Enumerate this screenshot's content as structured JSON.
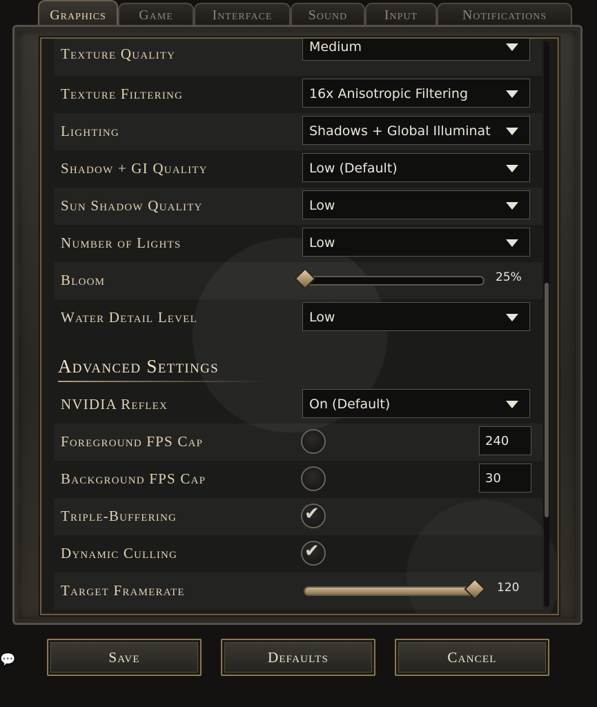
{
  "tabs": [
    {
      "label": "Graphics",
      "active": true
    },
    {
      "label": "Game",
      "active": false
    },
    {
      "label": "Interface",
      "active": false
    },
    {
      "label": "Sound",
      "active": false
    },
    {
      "label": "Input",
      "active": false
    },
    {
      "label": "Notifications",
      "active": false
    }
  ],
  "settings": {
    "texture_quality": {
      "label": "Texture Quality",
      "value": "Medium"
    },
    "texture_filtering": {
      "label": "Texture Filtering",
      "value": "16x Anisotropic Filtering"
    },
    "lighting": {
      "label": "Lighting",
      "value": "Shadows + Global Illuminat"
    },
    "shadow_gi_quality": {
      "label": "Shadow + GI Quality",
      "value": "Low (Default)"
    },
    "sun_shadow_quality": {
      "label": "Sun Shadow Quality",
      "value": "Low"
    },
    "number_of_lights": {
      "label": "Number of Lights",
      "value": "Low"
    },
    "bloom": {
      "label": "Bloom",
      "value": "25%",
      "level": 0.0
    },
    "water_detail": {
      "label": "Water Detail Level",
      "value": "Low"
    }
  },
  "advanced": {
    "title": "Advanced Settings",
    "nvidia_reflex": {
      "label": "NVIDIA Reflex",
      "value": "On (Default)"
    },
    "foreground_fps": {
      "label": "Foreground FPS Cap",
      "checked": false,
      "value": "240"
    },
    "background_fps": {
      "label": "Background FPS Cap",
      "checked": false,
      "value": "30"
    },
    "triple_buffering": {
      "label": "Triple-Buffering",
      "checked": true
    },
    "dynamic_culling": {
      "label": "Dynamic Culling",
      "checked": true
    },
    "target_framerate": {
      "label": "Target Framerate",
      "value": "120",
      "level": 1.0
    }
  },
  "icons": {
    "checkmark": "checkmark-icon",
    "dropdown": "chevron-down-icon",
    "chat": "chat-bubble-icon"
  },
  "buttons": {
    "save": "Save",
    "defaults": "Defaults",
    "cancel": "Cancel"
  },
  "colors": {
    "accent_gold": "#b8a07a",
    "text": "#e6d3b3",
    "panel": "#1b1b1a"
  }
}
